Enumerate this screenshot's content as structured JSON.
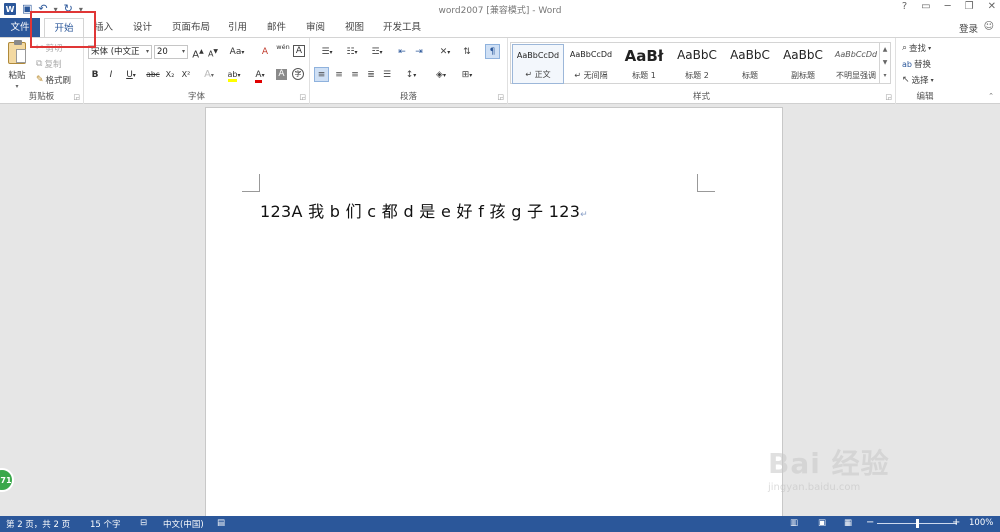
{
  "title_bar": {
    "title": "word2007 [兼容模式] - Word",
    "word_logo": "W",
    "qat_icons": [
      "save-icon",
      "undo-icon",
      "redo-icon",
      "customize-icon"
    ],
    "help": "?",
    "win_controls": [
      "ribbon-display-icon",
      "minimize-icon",
      "restore-icon",
      "close-icon"
    ]
  },
  "tabs": {
    "file": "文件",
    "items": [
      "开始",
      "插入",
      "设计",
      "页面布局",
      "引用",
      "邮件",
      "审阅",
      "视图",
      "开发工具"
    ],
    "active_index": 0,
    "login": "登录"
  },
  "ribbon": {
    "clipboard": {
      "paste": "粘贴",
      "cut": "剪切",
      "copy": "复制",
      "format_painter": "格式刷",
      "label": "剪贴板"
    },
    "font": {
      "font_name": "宋体 (中文正",
      "font_size": "20",
      "grow": "A",
      "shrink": "A",
      "case": "Aa",
      "clear": "A",
      "phonetic": "wén",
      "border_char": "A",
      "bold": "B",
      "italic": "I",
      "underline": "U",
      "strike": "abc",
      "subscript": "X₂",
      "superscript": "X²",
      "text_effect": "A",
      "highlight": "ab",
      "font_color": "A",
      "char_shading": "A",
      "enclose": "字",
      "label": "字体"
    },
    "paragraph": {
      "label": "段落"
    },
    "styles": {
      "label": "样式",
      "items": [
        {
          "sample": "AaBbCcDd",
          "name": "正文"
        },
        {
          "sample": "AaBbCcDd",
          "name": "无间隔"
        },
        {
          "sample": "AaBł",
          "name": "标题 1"
        },
        {
          "sample": "AaBbC",
          "name": "标题 2"
        },
        {
          "sample": "AaBbC",
          "name": "标题"
        },
        {
          "sample": "AaBbC",
          "name": "副标题"
        },
        {
          "sample": "AaBbCcDd",
          "name": "不明显强调"
        }
      ]
    },
    "editing": {
      "find": "查找",
      "replace": "替换",
      "select": "选择",
      "label": "编辑"
    }
  },
  "document": {
    "text": "123A 我 b 们 c 都 d 是 e 好 f 孩 g 子 123",
    "para_mark": "↵"
  },
  "watermark": {
    "main": "Bai 经验",
    "sub": "jingyan.baidu.com"
  },
  "badge": "71",
  "status": {
    "page": "第 2 页，共 2 页",
    "words": "15 个字",
    "language": "中文(中国)",
    "zoom": "100%",
    "zoom_minus": "−",
    "zoom_plus": "+",
    "zoom_fraction": 0.5
  },
  "colors": {
    "brand": "#2b579a",
    "highlight_box": "#e03636",
    "font_color_bar": "#e00000",
    "highlight_bar": "#ffff00"
  }
}
